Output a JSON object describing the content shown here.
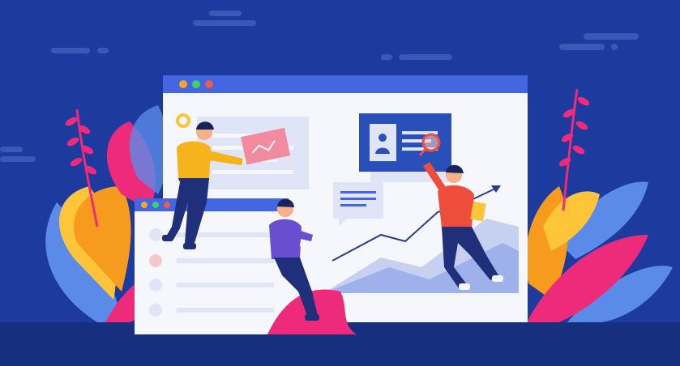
{
  "scene": {
    "type": "flat-vector-illustration",
    "theme": "team working with web browser windows, analytics chart and profile card",
    "colors": {
      "background": "#1d3a9e",
      "background_dark": "#16307f",
      "cloud": "#3a58b8",
      "window_bar": "#4466e2",
      "window_body": "#f5f7fd",
      "panel_light": "#dfe4f6",
      "chart_area_back": "#c6d1f2",
      "chart_area_front": "#9fb1ea",
      "profile_card": "#2950b8",
      "dot_orange": "#f7a42a",
      "dot_green": "#3ccf6a",
      "dot_red": "#f05a4a",
      "leaf_pink": "#ee2a7b",
      "leaf_orange": "#f79b1e",
      "leaf_blue": "#5a8be8",
      "leaf_yellow": "#ffc53a",
      "shirt_yellow": "#f6b31c",
      "shirt_purple": "#6a4ed1",
      "shirt_red": "#ef4d3c",
      "pants_navy": "#1f2f7a",
      "skin": "#f6b08a",
      "hair": "#1a2257"
    },
    "icons": [
      "lightbulb-icon",
      "person-silhouette-icon",
      "magnifier-icon",
      "trend-arrow-icon",
      "speech-bubble-icon"
    ],
    "figures": [
      "person-yellow-shirt",
      "person-purple-shirt",
      "person-red-shirt"
    ]
  }
}
